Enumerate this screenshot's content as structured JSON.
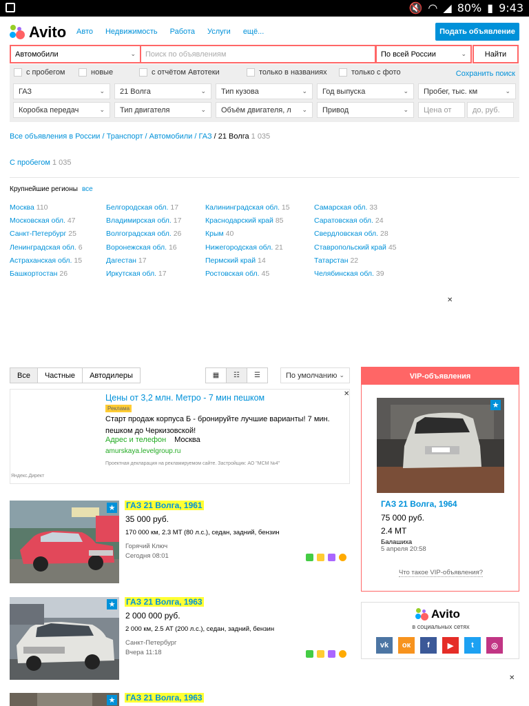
{
  "status": {
    "battery": "80%",
    "time": "9:43"
  },
  "header": {
    "logo": "Avito",
    "nav": [
      "Авто",
      "Недвижимость",
      "Работа",
      "Услуги",
      "ещё..."
    ],
    "post_button": "Подать объявление"
  },
  "search": {
    "category": "Автомобили",
    "placeholder": "Поиск по объявлениям",
    "region": "По всей России",
    "submit": "Найти"
  },
  "filters": {
    "checks": [
      "с пробегом",
      "новые",
      "с отчётом Автотеки",
      "только в названиях",
      "только с фото"
    ],
    "save": "Сохранить поиск",
    "row1": [
      "ГАЗ",
      "21 Волга",
      "Тип кузова",
      "Год выпуска",
      "Пробег, тыс. км"
    ],
    "row2": [
      "Коробка передач",
      "Тип двигателя",
      "Объём двигателя, л",
      "Привод"
    ],
    "price_from": "Цена от",
    "price_to": "до, руб."
  },
  "breadcrumbs": {
    "items": [
      "Все объявления в России",
      "Транспорт",
      "Автомобили",
      "ГАЗ"
    ],
    "current": "21 Волга",
    "count": "1 035"
  },
  "with_run": {
    "label": "С пробегом",
    "count": "1 035"
  },
  "regions": {
    "title": "Крупнейшие регионы",
    "all": "все",
    "col1": [
      [
        "Москва",
        "110"
      ],
      [
        "Московская обл.",
        "47"
      ],
      [
        "Санкт-Петербург",
        "25"
      ],
      [
        "Ленинградская обл.",
        "6"
      ],
      [
        "Астраханская обл.",
        "15"
      ],
      [
        "Башкортостан",
        "26"
      ]
    ],
    "col2": [
      [
        "Белгородская обл.",
        "17"
      ],
      [
        "Владимирская обл.",
        "17"
      ],
      [
        "Волгоградская обл.",
        "26"
      ],
      [
        "Воронежская обл.",
        "16"
      ],
      [
        "Дагестан",
        "17"
      ],
      [
        "Иркутская обл.",
        "17"
      ]
    ],
    "col3": [
      [
        "Калининградская обл.",
        "15"
      ],
      [
        "Краснодарский край",
        "85"
      ],
      [
        "Крым",
        "40"
      ],
      [
        "Нижегородская обл.",
        "21"
      ],
      [
        "Пермский край",
        "14"
      ],
      [
        "Ростовская обл.",
        "45"
      ]
    ],
    "col4": [
      [
        "Самарская обл.",
        "33"
      ],
      [
        "Саратовская обл.",
        "24"
      ],
      [
        "Свердловская обл.",
        "28"
      ],
      [
        "Ставропольский край",
        "45"
      ],
      [
        "Татарстан",
        "22"
      ],
      [
        "Челябинская обл.",
        "39"
      ]
    ]
  },
  "tabs": [
    "Все",
    "Частные",
    "Автодилеры"
  ],
  "sort": "По умолчанию",
  "ad": {
    "heading": "Цены от 3,2 млн. Метро - 7 мин пешком",
    "badge": "Реклама",
    "body": "Старт продаж корпуса Б - бронируйте лучшие варианты! 7 мин. пешком до Черкизовской!",
    "contact": "Адрес и телефон",
    "city": "Москва",
    "url": "amurskaya.levelgroup.ru",
    "disclaimer": "Проектная декларация на рекламируемом сайте. Застройщик: АО \"МСМ №4\"",
    "source": "Яндекс.Директ"
  },
  "listings": [
    {
      "title": "ГАЗ 21 Волга, 1961",
      "price": "35 000 руб.",
      "params": "170 000 км, 2.3 MT (80 л.с.), седан, задний, бензин",
      "location": "Горячий Ключ",
      "date": "Сегодня 08:01"
    },
    {
      "title": "ГАЗ 21 Волга, 1963",
      "price": "2 000 000 руб.",
      "params": "2 000 км, 2.5 AT (200 л.с.), седан, задний, бензин",
      "location": "Санкт-Петербург",
      "date": "Вчера 11:18"
    },
    {
      "title": "ГАЗ 21 Волга, 1963"
    }
  ],
  "vip": {
    "header": "VIP-объявления",
    "title": "ГАЗ 21 Волга, 1964",
    "price": "75 000 руб.",
    "params": "2.4 MT",
    "location": "Балашиха",
    "date": "5 апреля 20:58",
    "what": "Что такое VIP-объявления?"
  },
  "social": {
    "logo": "Avito",
    "subtitle": "в социальных сетях"
  },
  "colors": {
    "accent": "#0091d9",
    "brand_red": "#ff6666",
    "highlight": "#ffff33"
  }
}
